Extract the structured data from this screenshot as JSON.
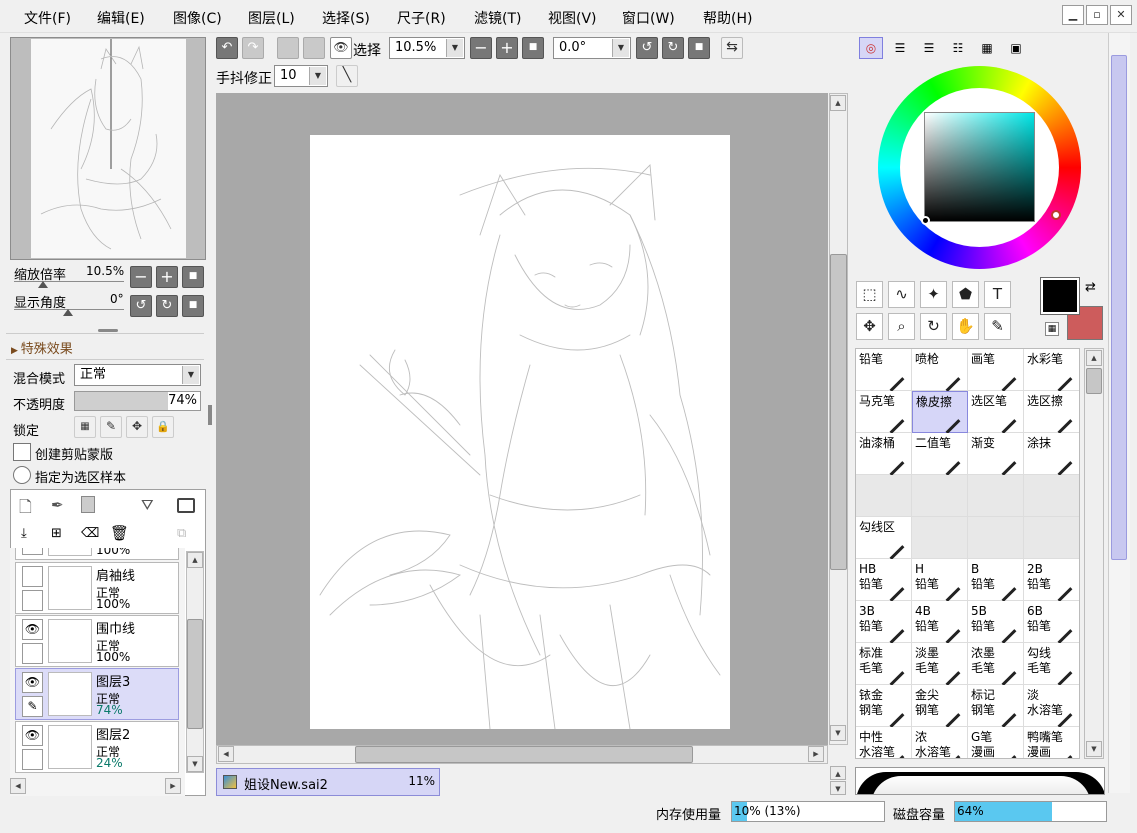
{
  "menu": [
    "文件(F)",
    "编辑(E)",
    "图像(C)",
    "图层(L)",
    "选择(S)",
    "尺子(R)",
    "滤镜(T)",
    "视图(V)",
    "窗口(W)",
    "帮助(H)"
  ],
  "window_controls": {
    "minimize": "▁",
    "restore": "▫",
    "close": "✕"
  },
  "toolbar": {
    "selection_label": "选择",
    "zoom_value": "10.5%",
    "rotation_value": "0.0°",
    "stabilizer_label": "手抖修正",
    "stabilizer_value": "10",
    "undo_icon": "undo-icon",
    "redo_icon": "redo-icon"
  },
  "navigator": {
    "zoom_label": "缩放倍率",
    "zoom_value": "10.5%",
    "angle_label": "显示角度",
    "angle_value": "0°"
  },
  "effects": {
    "title": "特殊效果"
  },
  "layer_props": {
    "blend_label": "混合模式",
    "blend_value": "正常",
    "opacity_label": "不透明度",
    "opacity_value": "74%",
    "opacity_fraction": 0.74,
    "lock_label": "锁定",
    "clip_label": "创建剪贴蒙版",
    "sample_label": "指定为选区样本"
  },
  "layers": [
    {
      "name": "肩袖线",
      "mode": "正常",
      "opacity": "100%",
      "visible": false,
      "selected": false
    },
    {
      "name": "围巾线",
      "mode": "正常",
      "opacity": "100%",
      "visible": true,
      "selected": false
    },
    {
      "name": "图层3",
      "mode": "正常",
      "opacity": "74%",
      "visible": true,
      "selected": true
    },
    {
      "name": "图层2",
      "mode": "正常",
      "opacity": "24%",
      "visible": true,
      "selected": false
    }
  ],
  "layer_partial_opacity": "100%",
  "document_tab": {
    "name": "姐设New.sai2",
    "zoom": "11%"
  },
  "colors": {
    "primary": "#000000",
    "secondary": "#cd5c5c",
    "accent_select": "#d6d6f6"
  },
  "color_modes": [
    "color-wheel-icon",
    "rgb-slider-icon",
    "hsv-slider-icon",
    "swatch-icon",
    "scratchpad-icon",
    "palette-icon"
  ],
  "tools": [
    "rect-select-icon",
    "lasso-icon",
    "magic-wand-icon",
    "shape-icon",
    "text-icon",
    "move-icon",
    "zoom-icon",
    "rotate-icon",
    "hand-icon",
    "eyedropper-icon"
  ],
  "brushes": [
    {
      "l1": "铅笔",
      "l2": ""
    },
    {
      "l1": "喷枪",
      "l2": ""
    },
    {
      "l1": "画笔",
      "l2": ""
    },
    {
      "l1": "水彩笔",
      "l2": ""
    },
    {
      "l1": "马克笔",
      "l2": ""
    },
    {
      "l1": "橡皮擦",
      "l2": "",
      "sel": true
    },
    {
      "l1": "选区笔",
      "l2": ""
    },
    {
      "l1": "选区擦",
      "l2": ""
    },
    {
      "l1": "油漆桶",
      "l2": ""
    },
    {
      "l1": "二值笔",
      "l2": ""
    },
    {
      "l1": "渐变",
      "l2": ""
    },
    {
      "l1": "涂抹",
      "l2": ""
    },
    {
      "l1": "",
      "l2": "",
      "empty": true
    },
    {
      "l1": "",
      "l2": "",
      "empty": true
    },
    {
      "l1": "",
      "l2": "",
      "empty": true
    },
    {
      "l1": "",
      "l2": "",
      "empty": true
    },
    {
      "l1": "勾线区",
      "l2": ""
    },
    {
      "l1": "",
      "l2": "",
      "empty": true
    },
    {
      "l1": "",
      "l2": "",
      "empty": true
    },
    {
      "l1": "",
      "l2": "",
      "empty": true
    },
    {
      "l1": "HB",
      "l2": "铅笔"
    },
    {
      "l1": "H",
      "l2": "铅笔"
    },
    {
      "l1": "B",
      "l2": "铅笔"
    },
    {
      "l1": "2B",
      "l2": "铅笔"
    },
    {
      "l1": "3B",
      "l2": "铅笔"
    },
    {
      "l1": "4B",
      "l2": "铅笔"
    },
    {
      "l1": "5B",
      "l2": "铅笔"
    },
    {
      "l1": "6B",
      "l2": "铅笔"
    },
    {
      "l1": "标准",
      "l2": "毛笔"
    },
    {
      "l1": "淡墨",
      "l2": "毛笔"
    },
    {
      "l1": "浓墨",
      "l2": "毛笔"
    },
    {
      "l1": "勾线",
      "l2": "毛笔"
    },
    {
      "l1": "铱金",
      "l2": "钢笔"
    },
    {
      "l1": "金尖",
      "l2": "钢笔"
    },
    {
      "l1": "标记",
      "l2": "钢笔"
    },
    {
      "l1": "淡",
      "l2": "水溶笔"
    },
    {
      "l1": "中性",
      "l2": "水溶笔"
    },
    {
      "l1": "浓",
      "l2": "水溶笔"
    },
    {
      "l1": "G笔",
      "l2": "漫画"
    },
    {
      "l1": "鸭嘴笔",
      "l2": "漫画"
    }
  ],
  "status": {
    "mem_label": "内存使用量",
    "mem_value": "10% (13%)",
    "mem_fraction": 0.1,
    "disk_label": "磁盘容量",
    "disk_value": "64%",
    "disk_fraction": 0.64
  }
}
